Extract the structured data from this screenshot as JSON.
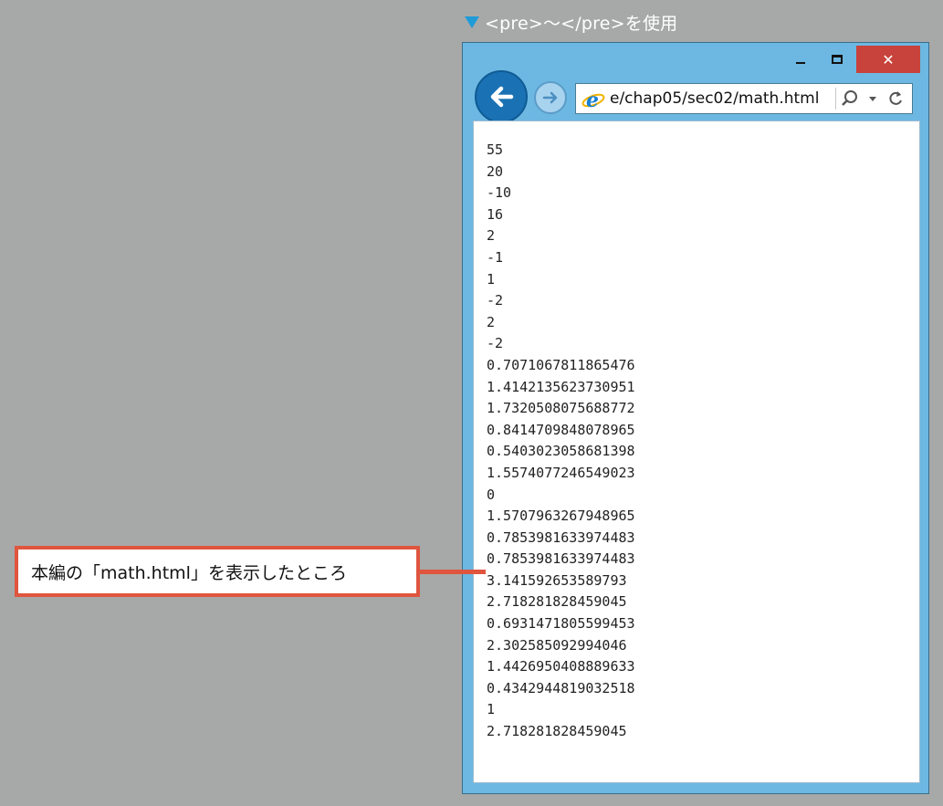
{
  "caption": {
    "text": "<pre>～</pre>を使用",
    "marker_color": "#1f9bd8"
  },
  "window": {
    "controls": {
      "minimize": "minimize",
      "maximize": "maximize",
      "close": "✕"
    },
    "address_bar": {
      "url": "e/chap05/sec02/math.html"
    },
    "output_lines": [
      "55",
      "20",
      "-10",
      "16",
      "2",
      "-1",
      "1",
      "-2",
      "2",
      "-2",
      "0.7071067811865476",
      "1.4142135623730951",
      "1.7320508075688772",
      "0.8414709848078965",
      "0.5403023058681398",
      "1.5574077246549023",
      "0",
      "1.5707963267948965",
      "0.7853981633974483",
      "0.7853981633974483",
      "3.141592653589793",
      "2.718281828459045",
      "0.6931471805599453",
      "2.302585092994046",
      "1.4426950408889633",
      "0.4342944819032518",
      "1",
      "2.718281828459045"
    ]
  },
  "callout": {
    "text": "本編の「math.html」を表示したところ",
    "border_color": "#e0553e"
  },
  "icons": [
    "back-arrow-icon",
    "forward-arrow-icon",
    "ie-logo-icon",
    "search-icon",
    "dropdown-icon",
    "refresh-icon"
  ]
}
